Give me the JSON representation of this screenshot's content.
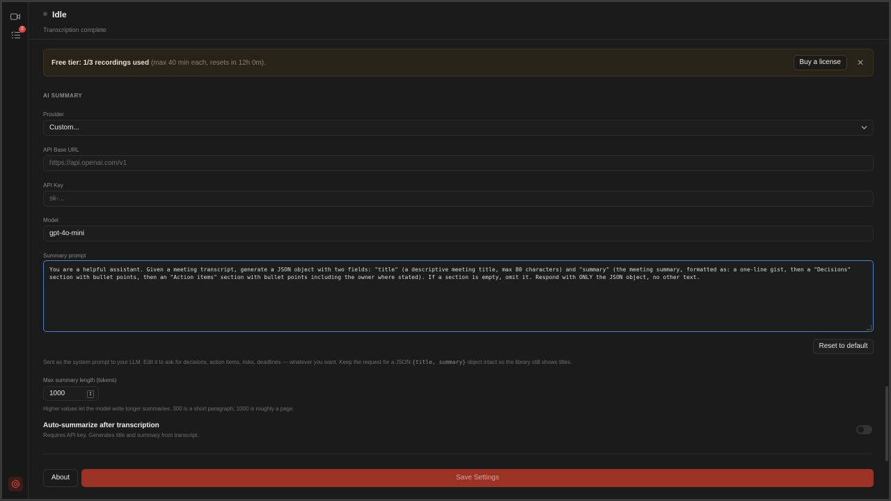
{
  "colors": {
    "accent_red": "#9b3226",
    "focus_blue": "#4c82c9",
    "badge_red": "#e0463c",
    "banner_bg": "#272318"
  },
  "rail": {
    "icons": [
      "video-icon",
      "tasks-icon",
      "settings-icon"
    ],
    "badge_count": "2"
  },
  "status": {
    "title": "Idle",
    "subtitle": "Transcription complete"
  },
  "banner": {
    "strong_text": "Free tier: 1/3 recordings used",
    "muted_text": "(max 40 min each, resets in 12h 0m).",
    "button_label": "Buy a license",
    "close_glyph": "✕"
  },
  "ai_summary": {
    "section_title": "AI SUMMARY",
    "provider": {
      "label": "Provider",
      "value": "Custom..."
    },
    "api_base_url": {
      "label": "API Base URL",
      "placeholder": "https://api.openai.com/v1"
    },
    "api_key": {
      "label": "API Key",
      "placeholder": "sk-..."
    },
    "model": {
      "label": "Model",
      "value": "gpt-4o-mini"
    },
    "summary_prompt": {
      "label": "Summary prompt",
      "value": "You are a helpful assistant. Given a meeting transcript, generate a JSON object with two fields: \"title\" (a descriptive meeting title, max 80 characters) and \"summary\" (the meeting summary, formatted as: a one-line gist, then a \"Decisions\" section with bullet points, then an \"Action items\" section with bullet points including the owner where stated). If a section is empty, omit it. Respond with ONLY the JSON object, no other text."
    },
    "reset_label": "Reset to default",
    "prompt_help_before": "Sent as the system prompt to your LLM. Edit it to ask for decisions, action items, risks, deadlines — whatever you want. Keep the request for a JSON",
    "prompt_help_code": "{title, summary}",
    "prompt_help_after": "object intact so the library still shows titles.",
    "max_length": {
      "label": "Max summary length (tokens)",
      "value": "1000"
    },
    "max_length_help": "Higher values let the model write longer summaries. 300 is a short paragraph; 1000 is roughly a page.",
    "auto_summarize": {
      "label": "Auto-summarize after transcription",
      "help": "Requires API key. Generates title and summary from transcript.",
      "enabled": false
    }
  },
  "footer": {
    "about_label": "About",
    "save_label": "Save Settings"
  }
}
